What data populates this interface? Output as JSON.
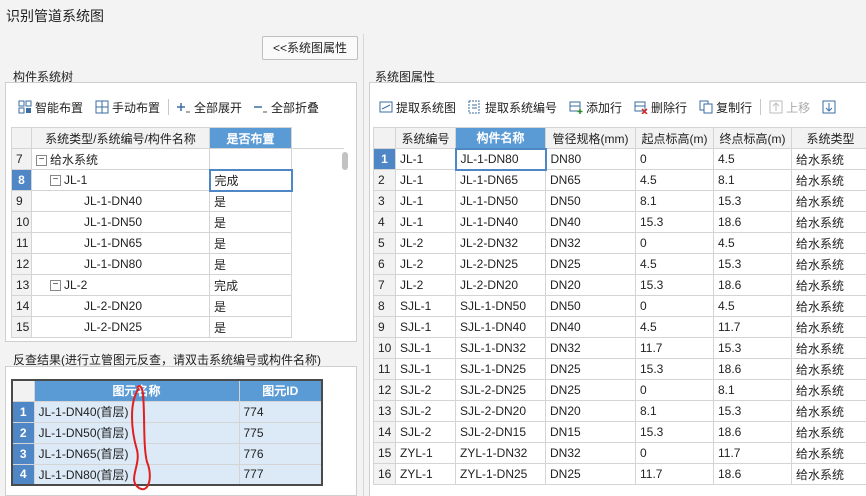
{
  "window": {
    "title": "识别管道系统图"
  },
  "toggle_button": {
    "label": "<<系统图属性"
  },
  "left": {
    "tree_section_label": "构件系统树",
    "toolbar": [
      {
        "label": "智能布置",
        "icon": "smart-layout-icon"
      },
      {
        "label": "手动布置",
        "icon": "manual-layout-icon"
      },
      {
        "label": "全部展开",
        "icon": "expand-all-icon"
      },
      {
        "label": "全部折叠",
        "icon": "collapse-all-icon"
      }
    ],
    "tree_table": {
      "headers": [
        "系统类型/系统编号/构件名称",
        "是否布置"
      ],
      "rows": [
        {
          "num": "7",
          "level": 0,
          "expander": "−",
          "name": "给水系统",
          "placed": ""
        },
        {
          "num": "8",
          "level": 1,
          "expander": "−",
          "name": "JL-1",
          "placed": "完成",
          "selected": true
        },
        {
          "num": "9",
          "level": 2,
          "expander": "",
          "name": "JL-1-DN40",
          "placed": "是"
        },
        {
          "num": "10",
          "level": 2,
          "expander": "",
          "name": "JL-1-DN50",
          "placed": "是"
        },
        {
          "num": "11",
          "level": 2,
          "expander": "",
          "name": "JL-1-DN65",
          "placed": "是"
        },
        {
          "num": "12",
          "level": 2,
          "expander": "",
          "name": "JL-1-DN80",
          "placed": "是"
        },
        {
          "num": "13",
          "level": 1,
          "expander": "−",
          "name": "JL-2",
          "placed": "完成"
        },
        {
          "num": "14",
          "level": 2,
          "expander": "",
          "name": "JL-2-DN20",
          "placed": "是"
        },
        {
          "num": "15",
          "level": 2,
          "expander": "",
          "name": "JL-2-DN25",
          "placed": "是"
        }
      ]
    },
    "result_section_label": "反查结果(进行立管图元反查，请双击系统编号或构件名称)",
    "result_table": {
      "headers": [
        "图元名称",
        "图元ID"
      ],
      "rows": [
        {
          "num": "1",
          "name": "JL-1-DN40(首层)",
          "id": "774"
        },
        {
          "num": "2",
          "name": "JL-1-DN50(首层)",
          "id": "775"
        },
        {
          "num": "3",
          "name": "JL-1-DN65(首层)",
          "id": "776"
        },
        {
          "num": "4",
          "name": "JL-1-DN80(首层)",
          "id": "777"
        }
      ]
    }
  },
  "right": {
    "section_label": "系统图属性",
    "toolbar": [
      {
        "label": "提取系统图",
        "icon": "extract-diagram-icon"
      },
      {
        "label": "提取系统编号",
        "icon": "extract-number-icon"
      },
      {
        "label": "添加行",
        "icon": "add-row-icon"
      },
      {
        "label": "删除行",
        "icon": "delete-row-icon"
      },
      {
        "label": "复制行",
        "icon": "copy-row-icon"
      },
      {
        "label": "上移",
        "icon": "move-up-icon"
      }
    ],
    "table": {
      "headers": [
        "系统编号",
        "构件名称",
        "管径规格(mm)",
        "起点标高(m)",
        "终点标高(m)",
        "系统类型"
      ],
      "rows": [
        [
          "1",
          "JL-1",
          "JL-1-DN80",
          "DN80",
          "0",
          "4.5",
          "给水系统"
        ],
        [
          "2",
          "JL-1",
          "JL-1-DN65",
          "DN65",
          "4.5",
          "8.1",
          "给水系统"
        ],
        [
          "3",
          "JL-1",
          "JL-1-DN50",
          "DN50",
          "8.1",
          "15.3",
          "给水系统"
        ],
        [
          "4",
          "JL-1",
          "JL-1-DN40",
          "DN40",
          "15.3",
          "18.6",
          "给水系统"
        ],
        [
          "5",
          "JL-2",
          "JL-2-DN32",
          "DN32",
          "0",
          "4.5",
          "给水系统"
        ],
        [
          "6",
          "JL-2",
          "JL-2-DN25",
          "DN25",
          "4.5",
          "15.3",
          "给水系统"
        ],
        [
          "7",
          "JL-2",
          "JL-2-DN20",
          "DN20",
          "15.3",
          "18.6",
          "给水系统"
        ],
        [
          "8",
          "SJL-1",
          "SJL-1-DN50",
          "DN50",
          "0",
          "4.5",
          "给水系统"
        ],
        [
          "9",
          "SJL-1",
          "SJL-1-DN40",
          "DN40",
          "4.5",
          "11.7",
          "给水系统"
        ],
        [
          "10",
          "SJL-1",
          "SJL-1-DN32",
          "DN32",
          "11.7",
          "15.3",
          "给水系统"
        ],
        [
          "11",
          "SJL-1",
          "SJL-1-DN25",
          "DN25",
          "15.3",
          "18.6",
          "给水系统"
        ],
        [
          "12",
          "SJL-2",
          "SJL-2-DN25",
          "DN25",
          "0",
          "8.1",
          "给水系统"
        ],
        [
          "13",
          "SJL-2",
          "SJL-2-DN20",
          "DN20",
          "8.1",
          "15.3",
          "给水系统"
        ],
        [
          "14",
          "SJL-2",
          "SJL-2-DN15",
          "DN15",
          "15.3",
          "18.6",
          "给水系统"
        ],
        [
          "15",
          "ZYL-1",
          "ZYL-1-DN32",
          "DN32",
          "0",
          "11.7",
          "给水系统"
        ],
        [
          "16",
          "ZYL-1",
          "ZYL-1-DN25",
          "DN25",
          "11.7",
          "18.6",
          "给水系统"
        ]
      ]
    }
  },
  "colors": {
    "header_highlight": "#5b9bd5",
    "row_selected": "#4f86c6",
    "annotation_red": "#e02020",
    "result_row_bg": "#dce9f7"
  }
}
